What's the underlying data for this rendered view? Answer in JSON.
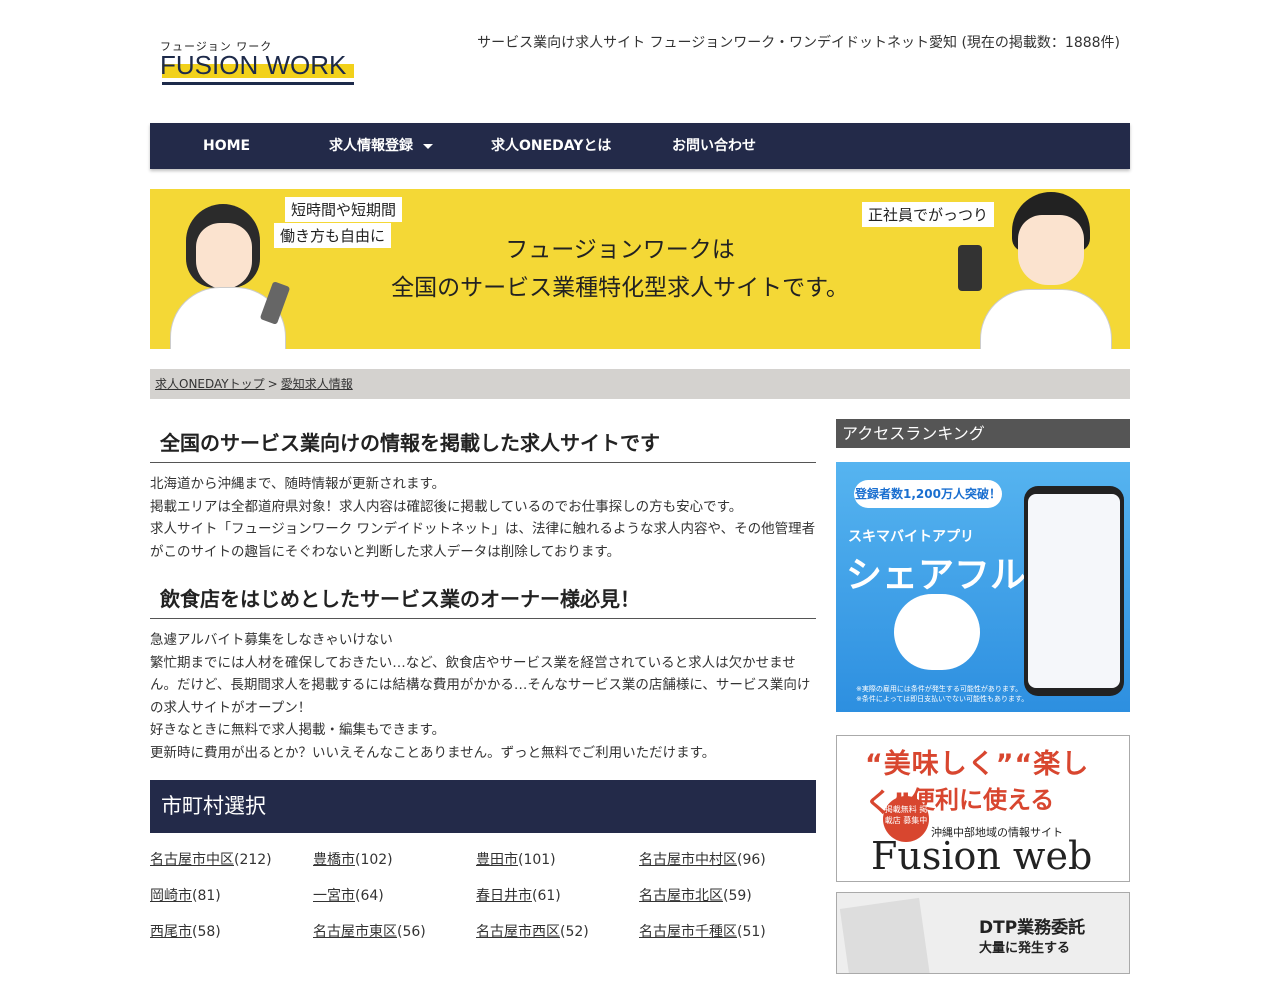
{
  "header": {
    "logo_kana": "フュージョン ワーク",
    "logo_text": "FUSION WORK",
    "tagline": "サービス業向け求人サイト フュージョンワーク・ワンデイドットネット愛知 (現在の掲載数：1888件)"
  },
  "nav": {
    "items": [
      {
        "label": "HOME"
      },
      {
        "label": "求人情報登録"
      },
      {
        "label": "求人ONEDAYとは"
      },
      {
        "label": "お問い合わせ"
      }
    ]
  },
  "banner": {
    "bubble_left_1": "短時間や短期間",
    "bubble_left_2": "働き方も自由に",
    "bubble_right": "正社員でがっつり",
    "title_line1": "フュージョンワークは",
    "title_line2": "全国のサービス業種特化型求人サイトです。"
  },
  "breadcrumb": {
    "home": "求人ONEDAYトップ",
    "separator": ">",
    "current": "愛知求人情報"
  },
  "main": {
    "section1_title": "全国のサービス業向けの情報を掲載した求人サイトです",
    "section1_lines": [
      "北海道から沖縄まで、随時情報が更新されます。",
      "掲載エリアは全都道府県対象！求人内容は確認後に掲載しているのでお仕事探しの方も安心です。",
      "求人サイト「フュージョンワーク ワンデイドットネット」は、法律に触れるような求人内容や、その他管理者がこのサイトの趣旨にそぐわないと判断した求人データは削除しております。"
    ],
    "section2_title": "飲食店をはじめとしたサービス業のオーナー様必見！",
    "section2_lines": [
      "急遽アルバイト募集をしなきゃいけない",
      "繁忙期までには人材を確保しておきたい…など、飲食店やサービス業を経営されていると求人は欠かせません。だけど、長期間求人を掲載するには結構な費用がかかる…そんなサービス業の店舗様に、サービス業向けの求人サイトがオープン！",
      "好きなときに無料で求人掲載・編集もできます。",
      "更新時に費用が出るとか？いいえそんなことありません。ずっと無料でご利用いただけます。"
    ],
    "area_title": "市町村選択",
    "cities": [
      {
        "name": "名古屋市中区",
        "count": "(212)"
      },
      {
        "name": "豊橋市",
        "count": "(102)"
      },
      {
        "name": "豊田市",
        "count": "(101)"
      },
      {
        "name": "名古屋市中村区",
        "count": "(96)"
      },
      {
        "name": "岡崎市",
        "count": "(81)"
      },
      {
        "name": "一宮市",
        "count": "(64)"
      },
      {
        "name": "春日井市",
        "count": "(61)"
      },
      {
        "name": "名古屋市北区",
        "count": "(59)"
      },
      {
        "name": "西尾市",
        "count": "(58)"
      },
      {
        "name": "名古屋市東区",
        "count": "(56)"
      },
      {
        "name": "名古屋市西区",
        "count": "(52)"
      },
      {
        "name": "名古屋市千種区",
        "count": "(51)"
      }
    ]
  },
  "side": {
    "ranking_title": "アクセスランキング",
    "ad1": {
      "badge": "登録者数1,200万人突破！",
      "sub": "スキマバイトアプリ",
      "name": "シェアフル",
      "note1": "※実際の雇用には条件が発生する可能性があります。",
      "note2": "※条件によっては即日支払いでない可能性もあります。"
    },
    "ad2": {
      "title1": "“美味しく”“楽しく”",
      "title2": "便利に使える",
      "badge": "掲載無料 掲載店 募集中",
      "sub": "沖縄中部地域の情報サイト",
      "name": "Fusion web"
    },
    "ad3": {
      "title": "DTP業務委託",
      "sub": "大量に発生する"
    }
  },
  "colors": {
    "nav_bg": "#232a49",
    "banner_bg": "#f4d836",
    "crumb_bg": "#d4d2cf",
    "side_head_bg": "#555555",
    "accent_red": "#d8462f"
  }
}
